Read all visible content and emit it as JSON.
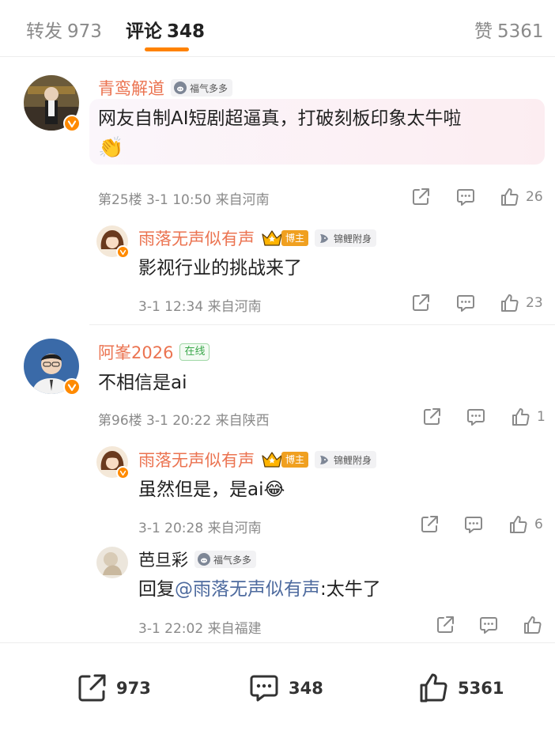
{
  "tabs": {
    "repost": {
      "label": "转发",
      "count": "973"
    },
    "comment": {
      "label": "评论",
      "count": "348"
    },
    "like": {
      "label": "赞",
      "count": "5361"
    }
  },
  "colors": {
    "accent": "#ff8200",
    "username": "#eb7350",
    "meta": "#8a8a8a"
  },
  "comments": [
    {
      "user": "青鸾解道",
      "badge": "福气多多",
      "text_line1": "网友自制AI短剧超逼真，打破刻板印象太牛啦",
      "emoji": "👏",
      "meta": "第25楼  3-1 10:50  来自河南",
      "likes": "26",
      "reply": {
        "user": "雨落无声似有声",
        "badge_role": "博主",
        "badge": "锦鲤附身",
        "text": "影视行业的挑战来了",
        "meta": "3-1 12:34  来自河南",
        "likes": "23"
      }
    },
    {
      "user": "阿峯2026",
      "badge": "在线",
      "text": "不相信是ai",
      "meta": "第96楼  3-1 20:22  来自陕西",
      "likes": "1",
      "replies": [
        {
          "user": "雨落无声似有声",
          "badge_role": "博主",
          "badge": "锦鲤附身",
          "text": "虽然但是，是ai",
          "emoji": "😂",
          "meta": "3-1 20:28  来自河南",
          "likes": "6"
        },
        {
          "user": "芭旦彩",
          "badge": "福气多多",
          "reply_prefix": "回复",
          "mention": "@雨落无声似有声",
          "text": ":太牛了",
          "meta": "3-1 22:02  来自福建"
        }
      ]
    }
  ],
  "bottombar": {
    "repost": "973",
    "comment": "348",
    "like": "5361"
  }
}
